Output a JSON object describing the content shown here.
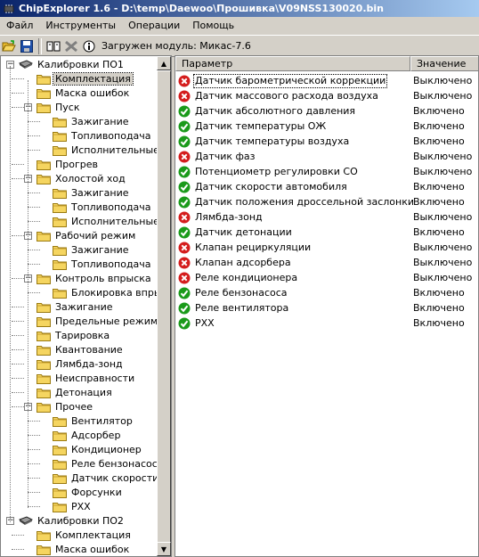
{
  "window": {
    "title": "ChipExplorer  1.6 - D:\\temp\\Daewoo\\Прошивка\\V09NSS130020.bin"
  },
  "menu": [
    "Файл",
    "Инструменты",
    "Операции",
    "Помощь"
  ],
  "toolbar": {
    "status": "Загружен модуль: Микас-7.6"
  },
  "tree": [
    {
      "label": "Калибровки ПО1",
      "level": 0,
      "kind": "chip",
      "expander": "minus"
    },
    {
      "label": "Комплектация",
      "level": 1,
      "kind": "folder",
      "selected": true
    },
    {
      "label": "Маска ошибок",
      "level": 1,
      "kind": "folder"
    },
    {
      "label": "Пуск",
      "level": 1,
      "kind": "folder",
      "expander": "minus"
    },
    {
      "label": "Зажигание",
      "level": 2,
      "kind": "folder"
    },
    {
      "label": "Топливоподача",
      "level": 2,
      "kind": "folder"
    },
    {
      "label": "Исполнительные м",
      "level": 2,
      "kind": "folder"
    },
    {
      "label": "Прогрев",
      "level": 1,
      "kind": "folder"
    },
    {
      "label": "Холостой ход",
      "level": 1,
      "kind": "folder",
      "expander": "minus"
    },
    {
      "label": "Зажигание",
      "level": 2,
      "kind": "folder"
    },
    {
      "label": "Топливоподача",
      "level": 2,
      "kind": "folder"
    },
    {
      "label": "Исполнительные м",
      "level": 2,
      "kind": "folder"
    },
    {
      "label": "Рабочий режим",
      "level": 1,
      "kind": "folder",
      "expander": "minus"
    },
    {
      "label": "Зажигание",
      "level": 2,
      "kind": "folder"
    },
    {
      "label": "Топливоподача",
      "level": 2,
      "kind": "folder"
    },
    {
      "label": "Контроль впрыска",
      "level": 1,
      "kind": "folder",
      "expander": "minus"
    },
    {
      "label": "Блокировка впрыс",
      "level": 2,
      "kind": "folder"
    },
    {
      "label": "Зажигание",
      "level": 1,
      "kind": "folder"
    },
    {
      "label": "Предельные режимы (",
      "level": 1,
      "kind": "folder"
    },
    {
      "label": "Тарировка",
      "level": 1,
      "kind": "folder"
    },
    {
      "label": "Квантование",
      "level": 1,
      "kind": "folder"
    },
    {
      "label": "Лямбда-зонд",
      "level": 1,
      "kind": "folder"
    },
    {
      "label": "Неисправности",
      "level": 1,
      "kind": "folder"
    },
    {
      "label": "Детонация",
      "level": 1,
      "kind": "folder"
    },
    {
      "label": "Прочее",
      "level": 1,
      "kind": "folder",
      "expander": "minus"
    },
    {
      "label": "Вентилятор",
      "level": 2,
      "kind": "folder"
    },
    {
      "label": "Адсорбер",
      "level": 2,
      "kind": "folder"
    },
    {
      "label": "Кондиционер",
      "level": 2,
      "kind": "folder"
    },
    {
      "label": "Реле бензонасоса",
      "level": 2,
      "kind": "folder"
    },
    {
      "label": "Датчик скорости",
      "level": 2,
      "kind": "folder"
    },
    {
      "label": "Форсунки",
      "level": 2,
      "kind": "folder"
    },
    {
      "label": "РХХ",
      "level": 2,
      "kind": "folder"
    },
    {
      "label": "Калибровки ПО2",
      "level": 0,
      "kind": "chip",
      "expander": "minus"
    },
    {
      "label": "Комплектация",
      "level": 1,
      "kind": "folder"
    },
    {
      "label": "Маска ошибок",
      "level": 1,
      "kind": "folder"
    }
  ],
  "list": {
    "columns": [
      "Параметр",
      "Значение"
    ],
    "rows": [
      {
        "name": "Датчик барометрической коррекции",
        "value": "Выключено",
        "state": "off",
        "selected": true
      },
      {
        "name": "Датчик массового расхода воздуха",
        "value": "Выключено",
        "state": "off"
      },
      {
        "name": "Датчик абсолютного давления",
        "value": "Включено",
        "state": "on"
      },
      {
        "name": "Датчик температуры ОЖ",
        "value": "Включено",
        "state": "on"
      },
      {
        "name": "Датчик температуры воздуха",
        "value": "Включено",
        "state": "on"
      },
      {
        "name": "Датчик фаз",
        "value": "Выключено",
        "state": "off"
      },
      {
        "name": "Потенциометр регулировки СО",
        "value": "Выключено",
        "state": "on"
      },
      {
        "name": "Датчик скорости автомобиля",
        "value": "Включено",
        "state": "on"
      },
      {
        "name": "Датчик положения дроссельной заслонки",
        "value": "Включено",
        "state": "on"
      },
      {
        "name": "Лямбда-зонд",
        "value": "Выключено",
        "state": "off"
      },
      {
        "name": "Датчик детонации",
        "value": "Включено",
        "state": "on"
      },
      {
        "name": "Клапан рециркуляции",
        "value": "Выключено",
        "state": "off"
      },
      {
        "name": "Клапан адсорбера",
        "value": "Выключено",
        "state": "off"
      },
      {
        "name": "Реле кондиционера",
        "value": "Выключено",
        "state": "off"
      },
      {
        "name": "Реле бензонасоса",
        "value": "Включено",
        "state": "on"
      },
      {
        "name": "Реле вентилятора",
        "value": "Включено",
        "state": "on"
      },
      {
        "name": "РХХ",
        "value": "Включено",
        "state": "on"
      }
    ]
  },
  "colors": {
    "on": "#1a9a1a",
    "off": "#d41c1c",
    "titlebar": "#0a246a"
  }
}
